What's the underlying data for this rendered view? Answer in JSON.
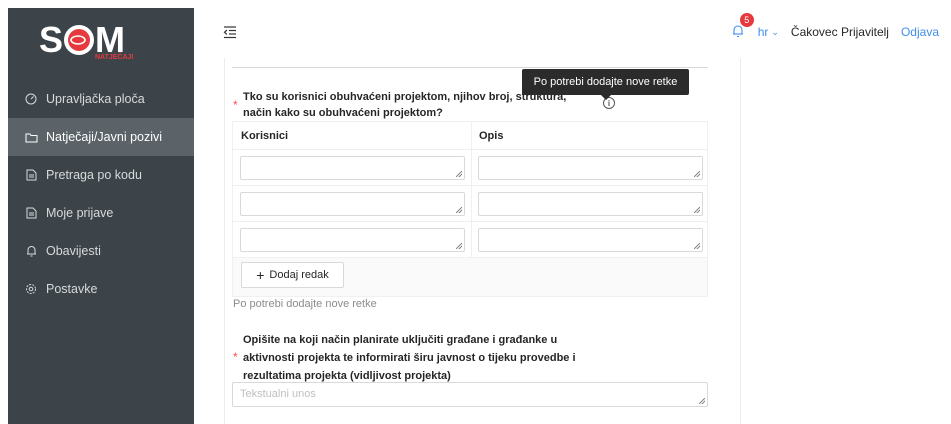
{
  "brand": {
    "logo_text": "S",
    "logo_sub": "NATJEČAJI",
    "logo_letter_m": "M",
    "accent": "#e6393e"
  },
  "sidebar": {
    "items": [
      {
        "label": "Upravljačka ploča",
        "icon": "dashboard-icon"
      },
      {
        "label": "Natječaji/Javni pozivi",
        "icon": "folder-icon",
        "active": true
      },
      {
        "label": "Pretraga po kodu",
        "icon": "document-icon"
      },
      {
        "label": "Moje prijave",
        "icon": "document-icon"
      },
      {
        "label": "Obavijesti",
        "icon": "bell-icon"
      },
      {
        "label": "Postavke",
        "icon": "gear-icon"
      }
    ]
  },
  "header": {
    "notifications_count": "5",
    "lang": "hr",
    "user": "Čakovec Prijavitelj",
    "logout": "Odjava"
  },
  "form": {
    "q1_label_line1": "Tko su korisnici obuhvaćeni projektom, njihov broj, struktura,",
    "q1_label_line2": "način kako su obuhvaćeni projektom?",
    "tooltip": "Po potrebi dodajte nove retke",
    "table": {
      "columns": [
        "Korisnici",
        "Opis"
      ],
      "rows": [
        [
          "",
          ""
        ],
        [
          "",
          ""
        ],
        [
          "",
          ""
        ]
      ]
    },
    "add_row": "Dodaj redak",
    "help": "Po potrebi dodajte nove retke",
    "q2_label_line1": "Opišite na koji način planirate uključiti građane i građanke u",
    "q2_label_line2": "aktivnosti projekta te informirati širu javnost o tijeku provedbe i",
    "q2_label_line3": "rezultatima projekta (vidljivost projekta)",
    "q2_placeholder": "Tekstualni unos"
  }
}
